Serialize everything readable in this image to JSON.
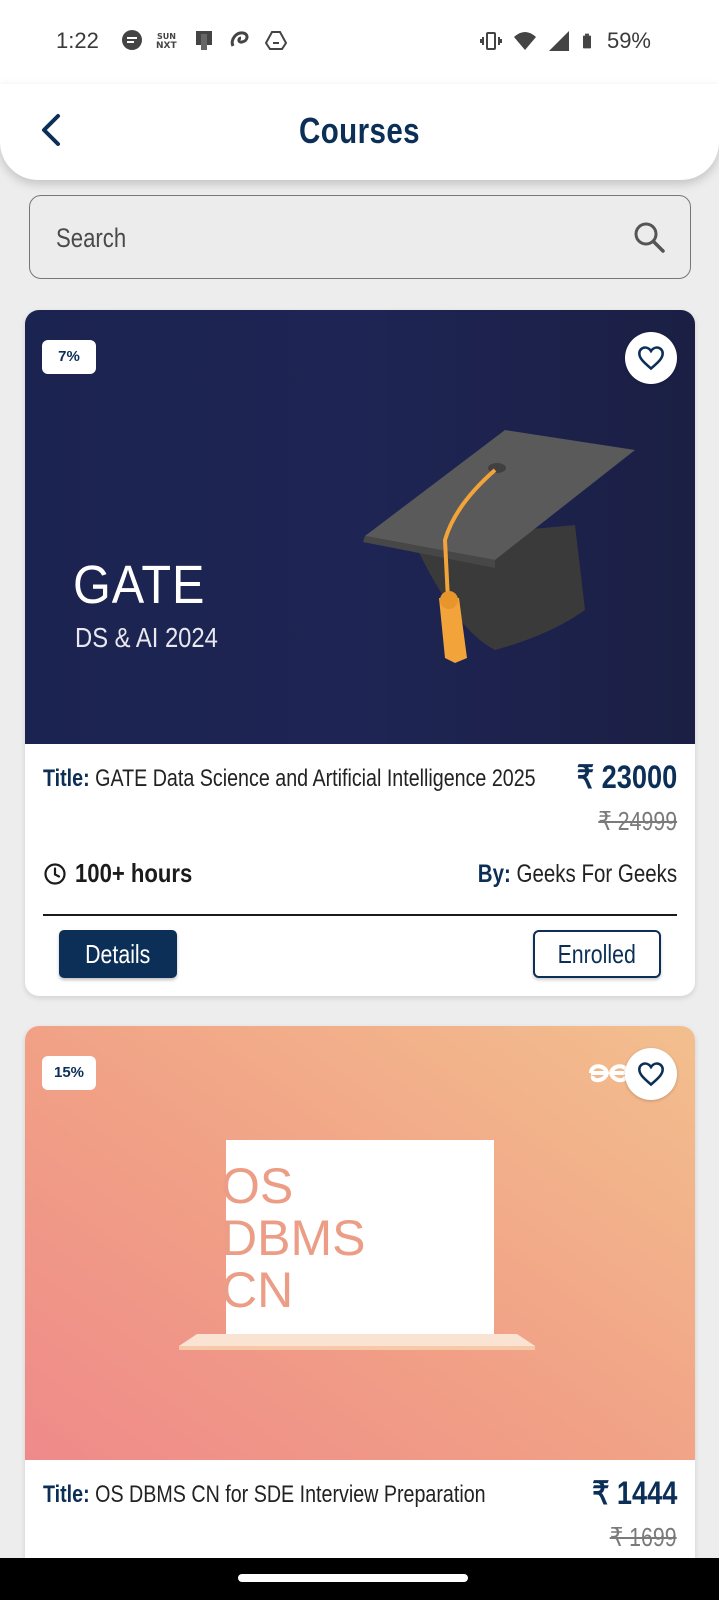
{
  "status_bar": {
    "time": "1:22",
    "battery": "59%",
    "icons_left": [
      "chat-notification-icon",
      "sunnxt-icon",
      "phone-app-icon",
      "airtel-icon",
      "drive-icon"
    ],
    "icons_right": [
      "vibrate-icon",
      "wifi-icon",
      "signal-icon",
      "battery-icon"
    ]
  },
  "header": {
    "title": "Courses"
  },
  "search": {
    "placeholder": "Search"
  },
  "courses": [
    {
      "discount": "7%",
      "banner": {
        "headline": "GATE",
        "subline": "DS & AI 2024"
      },
      "title_label": "Title:",
      "title": "GATE Data Science and Artificial Intelligence 2025",
      "price": "₹ 23000",
      "old_price": "₹ 24999",
      "hours": "100+ hours",
      "by_label": "By:",
      "by": "Geeks For Geeks",
      "details_label": "Details",
      "enroll_label": "Enrolled"
    },
    {
      "discount": "15%",
      "banner": {
        "line1": "OS",
        "line2": "DBMS",
        "line3": "CN"
      },
      "title_label": "Title:",
      "title": "OS DBMS CN for SDE Interview Preparation",
      "price": "₹ 1444",
      "old_price": "₹ 1699"
    }
  ],
  "colors": {
    "brand": "#0c2f57",
    "background": "#ededed",
    "banner1": "#1b2350",
    "banner2_start": "#ef8a8a",
    "banner2_end": "#f3bf8e"
  }
}
